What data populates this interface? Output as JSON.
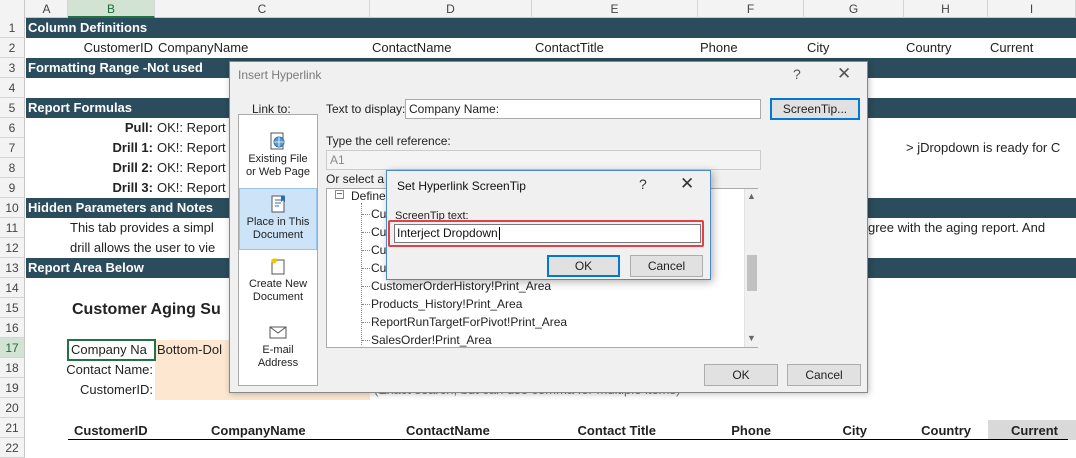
{
  "columns": [
    "A",
    "B",
    "C",
    "D",
    "E",
    "F",
    "G",
    "H",
    "I"
  ],
  "rows": [
    "1",
    "2",
    "3",
    "4",
    "5",
    "6",
    "7",
    "8",
    "9",
    "10",
    "11",
    "12",
    "13",
    "14",
    "15",
    "16",
    "17",
    "18",
    "19",
    "20",
    "21",
    "22"
  ],
  "bands": {
    "r1": "Column Definitions",
    "r3": "Formatting Range -Not used",
    "r5": "Report Formulas",
    "r10": "Hidden Parameters and Notes",
    "r13": "Report Area Below"
  },
  "row2": [
    "CustomerID",
    "CompanyName",
    "ContactName",
    "ContactTitle",
    "Phone",
    "City",
    "Country",
    "Current"
  ],
  "formulas": [
    {
      "label": "Pull:",
      "value": "OK!: Report"
    },
    {
      "label": "Drill 1:",
      "value": "OK!: Report"
    },
    {
      "label": "Drill 2:",
      "value": "OK!: Report"
    },
    {
      "label": "Drill 3:",
      "value": "OK!: Report"
    }
  ],
  "jdropdown_note": "> jDropdown is ready for C",
  "notes": {
    "line1_left": "This tab provides a simpl",
    "line1_right": "gree with the aging report. And",
    "line2_left": "drill allows the user to vie"
  },
  "report": {
    "title": "Customer Aging Su",
    "company_label": "Company Na",
    "company_value": "Bottom-Dol",
    "contact_label": "Contact Name:",
    "customer_label": "CustomerID:",
    "hint": "(Exact search, but can use comma for multiple items)"
  },
  "row21": [
    "CustomerID",
    "CompanyName",
    "ContactName",
    "Contact Title",
    "Phone",
    "City",
    "Country",
    "Current"
  ],
  "hyperlink_dialog": {
    "title": "Insert Hyperlink",
    "help": "?",
    "close": "✕",
    "link_to_label": "Link to:",
    "text_to_display_label": "Text to display:",
    "text_to_display_value": "Company Name:",
    "screentip_button": "ScreenTip...",
    "cell_ref_label": "Type the cell reference:",
    "cell_ref_value": "A1",
    "select_place_label": "Or select a p",
    "link_options": [
      {
        "line1": "Existing File",
        "line2": "or Web Page"
      },
      {
        "line1": "Place in This",
        "line2": "Document"
      },
      {
        "line1": "Create New",
        "line2": "Document"
      },
      {
        "line1": "E-mail",
        "line2": "Address"
      }
    ],
    "tree_root": "Defined",
    "tree_items": [
      "Cu",
      "Cu",
      "Cu",
      "Cu",
      "CustomerOrderHistory!Print_Area",
      "Products_History!Print_Area",
      "ReportRunTargetForPivot!Print_Area",
      "SalesOrder!Print_Area"
    ],
    "ok": "OK",
    "cancel": "Cancel"
  },
  "screentip_dialog": {
    "title": "Set Hyperlink ScreenTip",
    "help": "?",
    "close": "✕",
    "label": "ScreenTip text:",
    "value": "Interject Dropdown",
    "ok": "OK",
    "cancel": "Cancel"
  }
}
